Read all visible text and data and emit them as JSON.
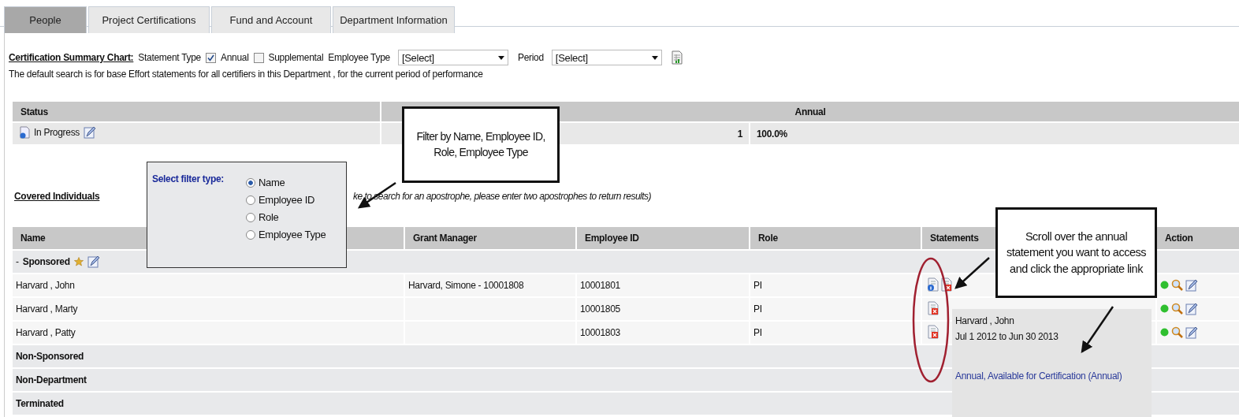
{
  "tabs": [
    {
      "label": "People",
      "selected": true
    },
    {
      "label": "Project Certifications",
      "selected": false
    },
    {
      "label": "Fund and Account",
      "selected": false
    },
    {
      "label": "Department Information",
      "selected": false
    }
  ],
  "filters": {
    "title": "Certification Summary Chart:",
    "statement_type_label": "Statement Type",
    "statement_types": [
      {
        "label": "Annual",
        "checked": true
      },
      {
        "label": "Supplemental",
        "checked": false
      }
    ],
    "employee_type": {
      "label": "Employee Type",
      "value": "[Select]"
    },
    "period": {
      "label": "Period",
      "value": "[Select]"
    }
  },
  "note": "The default search is for base Effort statements for all certifiers in this Department , for the current period of performance",
  "status_table": {
    "columns": [
      "Status",
      "Annual"
    ],
    "rows": [
      {
        "status": "In Progress",
        "count": "1",
        "percent": "100.0%"
      }
    ]
  },
  "covered_individuals": {
    "title": "Covered Individuals",
    "hint": "ke to search for an apostrophe, please enter two apostrophes to return results)"
  },
  "filter_popup": {
    "title": "Select filter type:",
    "options": [
      {
        "label": "Name",
        "selected": true
      },
      {
        "label": "Employee ID",
        "selected": false
      },
      {
        "label": "Role",
        "selected": false
      },
      {
        "label": "Employee Type",
        "selected": false
      }
    ]
  },
  "people_table": {
    "columns": [
      "Name",
      "Grant Manager",
      "Employee ID",
      "Role",
      "Statements",
      "Action"
    ],
    "groups": [
      {
        "label": "Sponsored",
        "toggle": "-",
        "favorite": true,
        "rows": [
          {
            "name": "Harvard , John",
            "grant_manager": "Harvard, Simone - 10001808",
            "employee_id": "10001801",
            "role": "PI",
            "statements": {
              "info": true,
              "error": true
            }
          },
          {
            "name": "Harvard , Marty",
            "employee_id": "10001805",
            "role": "PI",
            "statements": {
              "info": false,
              "error": true
            }
          },
          {
            "name": "Harvard , Patty",
            "employee_id": "10001803",
            "role": "PI",
            "statements": {
              "info": false,
              "error": true
            }
          }
        ]
      },
      {
        "label": "Non-Sponsored",
        "favorite": false
      },
      {
        "label": "Non-Department",
        "favorite": false
      },
      {
        "label": "Terminated",
        "favorite": false
      }
    ]
  },
  "tooltip": {
    "name": "Harvard , John",
    "period": "Jul 1 2012 to Jun 30 2013",
    "link": "Annual, Available for Certification (Annual)"
  },
  "callouts": [
    {
      "text": "Filter by Name, Employee ID, Role, Employee Type"
    },
    {
      "text": "Scroll over the annual statement you want to access and click the appropriate link"
    }
  ]
}
